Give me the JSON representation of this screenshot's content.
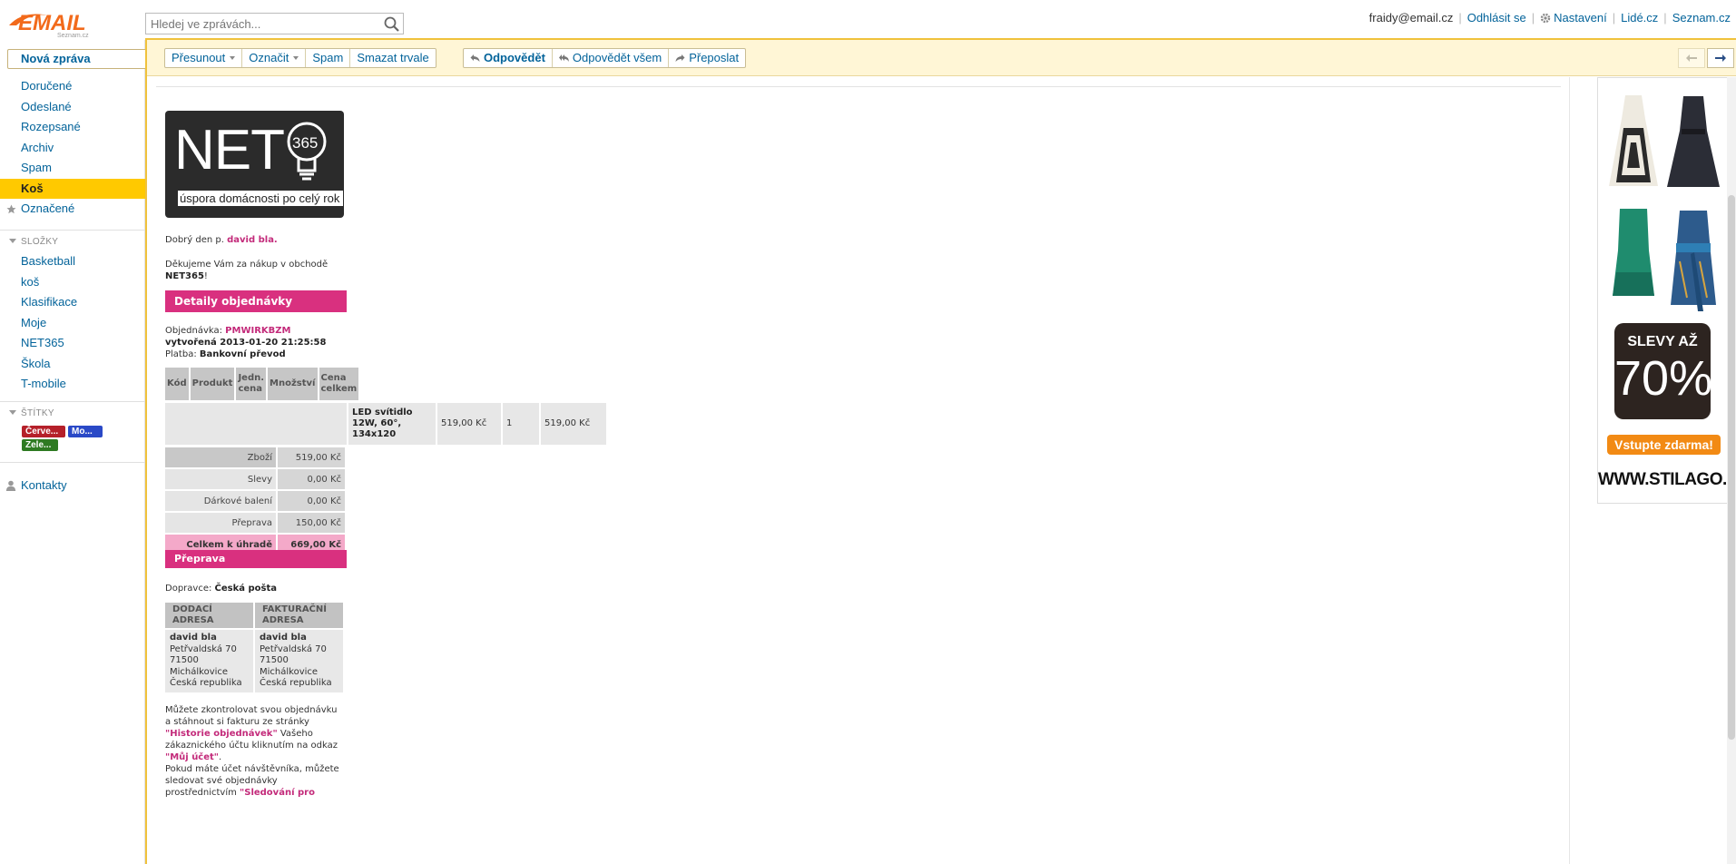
{
  "header": {
    "logo_text": "EMAIL",
    "logo_sub": "Seznam.cz",
    "search_placeholder": "Hledej ve zprávách...",
    "user_email": "fraidy@email.cz",
    "links": {
      "logout": "Odhlásit se",
      "settings": "Nastavení",
      "people": "Lidé.cz",
      "seznam": "Seznam.cz"
    }
  },
  "sidebar": {
    "compose": "Nová zpráva",
    "folders": [
      {
        "label": "Doručené"
      },
      {
        "label": "Odeslané"
      },
      {
        "label": "Rozepsané"
      },
      {
        "label": "Archiv"
      },
      {
        "label": "Spam"
      },
      {
        "label": "Koš",
        "active": true
      },
      {
        "label": "Označené",
        "icon": "star-icon"
      }
    ],
    "folders_heading": "SLOŽKY",
    "user_folders": [
      "Basketball",
      "koš",
      "Klasifikace",
      "Moje",
      "NET365",
      "Škola",
      "T-mobile"
    ],
    "labels_heading": "ŠTÍTKY",
    "labels": [
      {
        "text": "Červe...",
        "color": "#b5202a"
      },
      {
        "text": "Mo...",
        "color": "#2a49c7"
      },
      {
        "text": "Zele...",
        "color": "#2e7a22"
      }
    ],
    "contacts": "Kontakty"
  },
  "toolbar": {
    "move": "Přesunout",
    "mark": "Označit",
    "spam": "Spam",
    "delete": "Smazat trvale",
    "reply": "Odpovědět",
    "reply_all": "Odpovědět všem",
    "forward": "Přeposlat"
  },
  "email": {
    "logo_text": "NET",
    "logo_tagline": "úspora domácnosti po celý rok",
    "greeting_prefix": "Dobrý den p. ",
    "greeting_name": "david bla.",
    "thanks_prefix": "Děkujeme Vám za nákup v obchodě ",
    "thanks_shop": "NET365",
    "thanks_suffix": "!",
    "details_title": "Detaily objednávky",
    "order_label": "Objednávka: ",
    "order_id": "PMWIRKBZM",
    "created_label": "vytvořená 2013-01-20 21:25:58",
    "payment_label": "Platba: ",
    "payment_value": "Bankovní převod",
    "table_headers": [
      "Kód",
      "Produkt",
      "Jedn. cena",
      "Množství",
      "Cena celkem"
    ],
    "product": {
      "name": "LED svítidlo 12W, 60°, 134x120",
      "unit_price": "519,00 Kč",
      "qty": "1",
      "total": "519,00 Kč"
    },
    "totals": [
      {
        "label": "Zboží",
        "value": "519,00 Kč"
      },
      {
        "label": "Slevy",
        "value": "0,00 Kč"
      },
      {
        "label": "Dárkové balení",
        "value": "0,00 Kč"
      },
      {
        "label": "Přeprava",
        "value": "150,00 Kč"
      },
      {
        "label": "Celkem k úhradě",
        "value": "669,00 Kč"
      }
    ],
    "shipping_title": "Přeprava",
    "carrier_label": "Dopravce: ",
    "carrier": "Česká pošta",
    "address_headers": [
      "DODACÍ ADRESA",
      "FAKTURAČNÍ ADRESA"
    ],
    "address": {
      "name": "david bla",
      "street": "Petřvaldská 70",
      "zip": "71500",
      "city": "Michálkovice",
      "country": "Česká republika"
    },
    "para1_a": "Můžete zkontrolovat svou objednávku a stáhnout si fakturu ze stránky ",
    "para1_link": "\"Historie objednávek\"",
    "para1_b": " Vašeho zákaznického účtu kliknutím na odkaz ",
    "para1_link2": "\"Můj účet\"",
    "para1_c": ".",
    "para2_a": "Pokud máte účet návštěvníka, můžete sledovat své objednávky prostřednictvím ",
    "para2_link": "\"Sledování pro"
  },
  "ad": {
    "sale_line1": "SLEVY AŽ",
    "sale_line2": "70%",
    "cta": "Vstupte zdarma!",
    "url": "WWW.STILAGO.CZ"
  },
  "colors": {
    "accent": "#ffc900",
    "link": "#03639a",
    "pink": "#d9307f",
    "logo_orange": "#f26a1b"
  }
}
